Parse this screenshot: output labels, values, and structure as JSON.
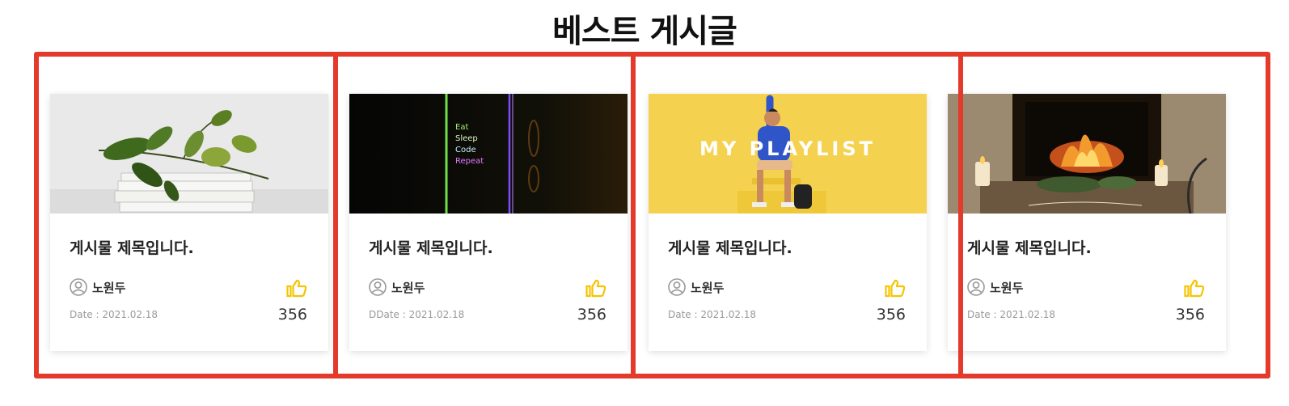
{
  "section": {
    "title": "베스트 게시글"
  },
  "colors": {
    "frame": "#e43a2c",
    "like": "#f5c400"
  },
  "icons": {
    "author": "user-circle-icon",
    "like": "thumbs-up-icon"
  },
  "cards": [
    {
      "image": "plant-on-books",
      "title": "게시물 제목입니다.",
      "author": "노원두",
      "date": "Date : 2021.02.18",
      "likes": "356"
    },
    {
      "image": "eat-sleep-code-repeat",
      "image_text": [
        "Eat",
        "Sleep",
        "Code",
        "Repeat"
      ],
      "title": "게시물 제목입니다.",
      "author": "노원두",
      "date": "DDate : 2021.02.18",
      "likes": "356"
    },
    {
      "image": "my-playlist",
      "image_text": "MY PLAYLIST",
      "title": "게시물 제목입니다.",
      "author": "노원두",
      "date": "Date : 2021.02.18",
      "likes": "356"
    },
    {
      "image": "fireplace",
      "title": "게시물 제목입니다.",
      "author": "노원두",
      "date": "Date : 2021.02.18",
      "likes": "356"
    }
  ]
}
